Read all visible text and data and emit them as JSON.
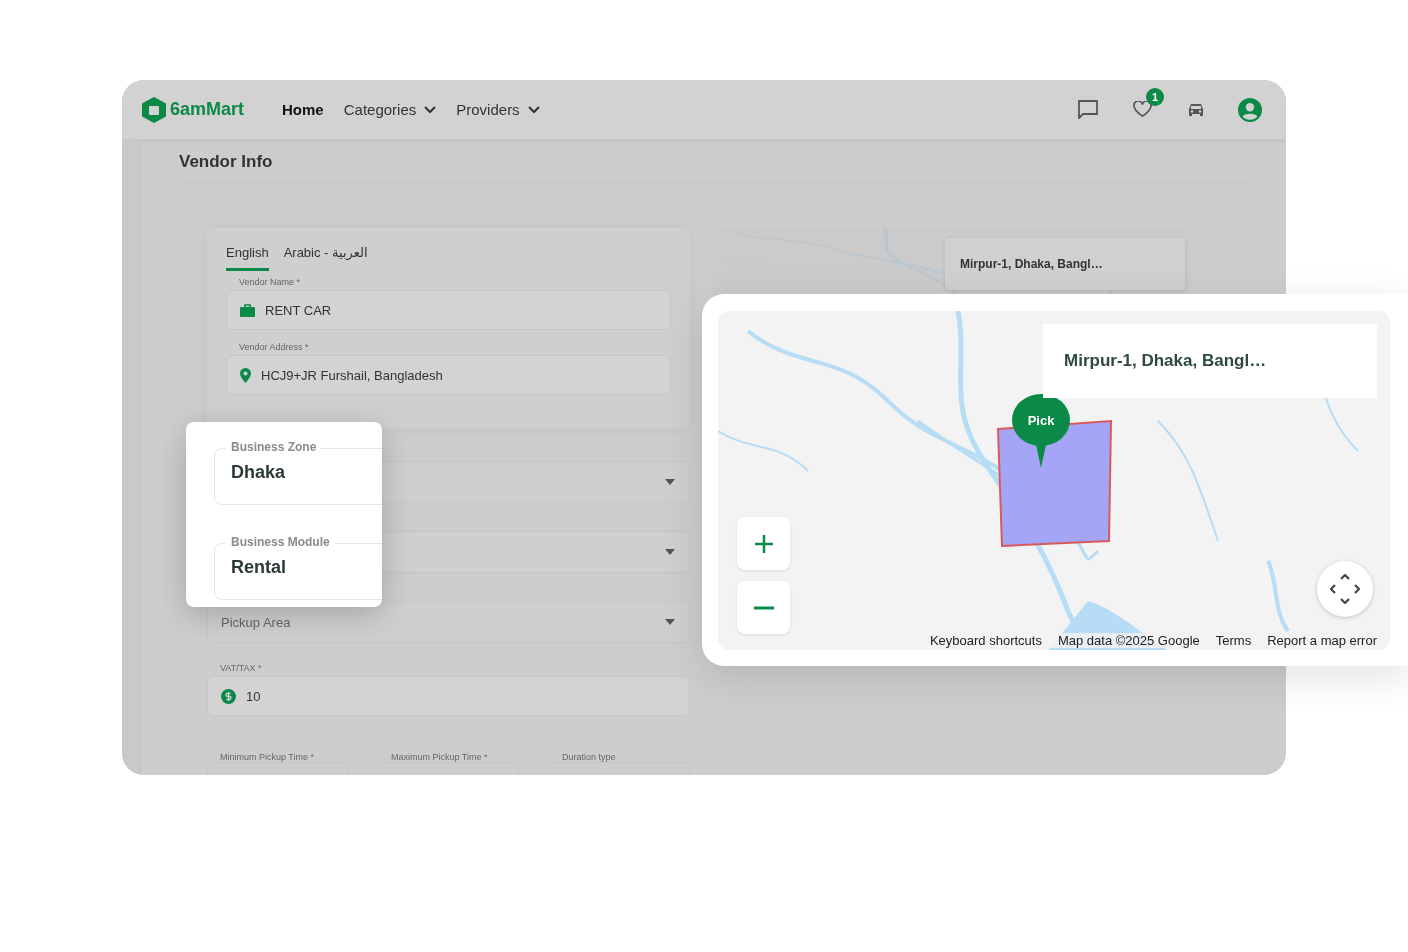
{
  "brand": {
    "name": "6amMart"
  },
  "nav": [
    {
      "label": "Home",
      "selected": true,
      "dropdown": false
    },
    {
      "label": "Categories",
      "selected": false,
      "dropdown": true
    },
    {
      "label": "Providers",
      "selected": false,
      "dropdown": true
    }
  ],
  "header_icons": [
    {
      "kind": "chat"
    },
    {
      "kind": "wishlist",
      "badge": "1"
    },
    {
      "kind": "car"
    },
    {
      "kind": "profile"
    }
  ],
  "section_title": "Vendor Info",
  "language_tabs": [
    {
      "label": "English",
      "selected": true
    },
    {
      "label": "Arabic - العربية",
      "selected": false
    }
  ],
  "vendor_fields": [
    {
      "label": "Vendor Name *",
      "value": "RENT CAR"
    },
    {
      "label": "Vendor Address *",
      "value": "HCJ9+JR Furshail, Bangladesh"
    }
  ],
  "pickup_area": {
    "placeholder": "Pickup Area"
  },
  "vat": {
    "label": "VAT/TAX *",
    "value": "10"
  },
  "time_fields": [
    {
      "label": "Minimum Pickup Time *"
    },
    {
      "label": "Maximum Pickup Time *"
    },
    {
      "label": "Duration type"
    }
  ],
  "back_map": {
    "search": "Mirpur-1, Dhaka, Bangl…"
  },
  "highlight_card": {
    "fields": [
      {
        "label": "Business Zone",
        "value": "Dhaka"
      },
      {
        "label": "Business Module",
        "value": "Rental"
      }
    ]
  },
  "map_card": {
    "search": "Mirpur-1, Dhaka, Bangl…",
    "marker": "Pick",
    "attribution": [
      "Keyboard shortcuts",
      "Map data ©2025 Google",
      "Terms",
      "Report a map error"
    ]
  }
}
